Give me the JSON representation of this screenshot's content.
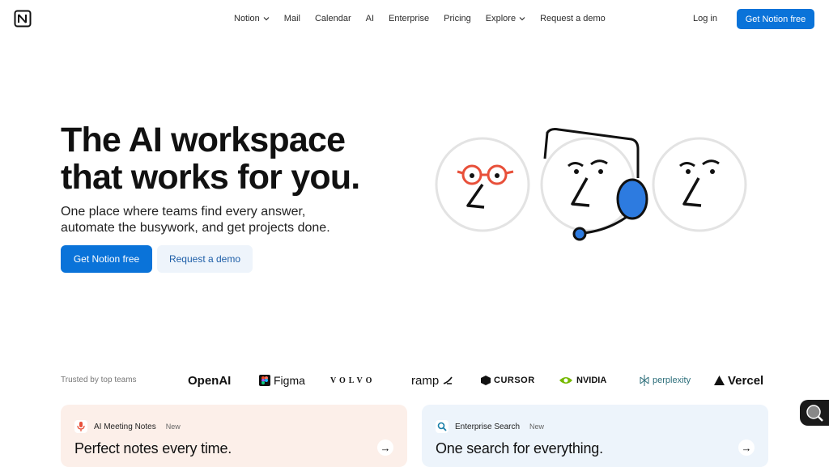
{
  "nav": {
    "logo_icon": "notion-logo-icon",
    "items": [
      {
        "label": "Notion",
        "dropdown": true
      },
      {
        "label": "Mail",
        "dropdown": false
      },
      {
        "label": "Calendar",
        "dropdown": false
      },
      {
        "label": "AI",
        "dropdown": false
      },
      {
        "label": "Enterprise",
        "dropdown": false
      },
      {
        "label": "Pricing",
        "dropdown": false
      },
      {
        "label": "Explore",
        "dropdown": true
      },
      {
        "label": "Request a demo",
        "dropdown": false
      }
    ],
    "login": "Log in",
    "cta": "Get Notion free"
  },
  "hero": {
    "title_line1": "The AI workspace",
    "title_line2": "that works for you.",
    "subtitle_line1": "One place where teams find every answer,",
    "subtitle_line2": "automate the busywork, and get projects done.",
    "cta_primary": "Get Notion free",
    "cta_secondary": "Request a demo"
  },
  "trusted": {
    "label": "Trusted by top teams",
    "logos": [
      "OpenAI",
      "Figma",
      "VOLVO",
      "ramp",
      "CURSOR",
      "NVIDIA",
      "perplexity",
      "Vercel"
    ]
  },
  "cards": [
    {
      "tag": "AI Meeting Notes",
      "badge": "New",
      "title": "Perfect notes every time.",
      "icon": "microphone-icon"
    },
    {
      "tag": "Enterprise Search",
      "badge": "New",
      "title": "One search for everything.",
      "icon": "search-icon"
    }
  ],
  "colors": {
    "accent": "#0a73d9",
    "card1_bg": "#fcefe9",
    "card2_bg": "#edf4fb"
  }
}
